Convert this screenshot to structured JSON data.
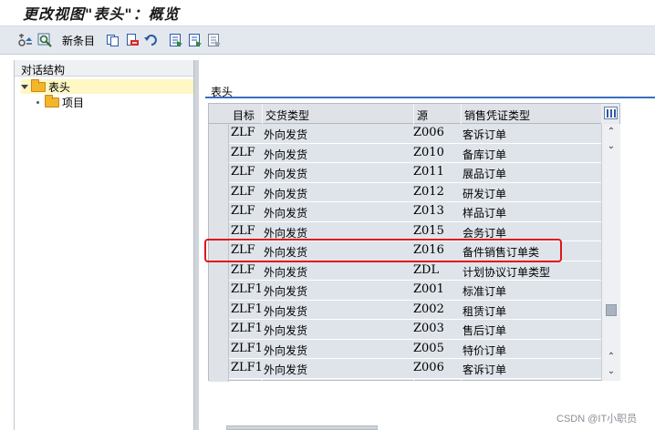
{
  "window": {
    "title": "更改视图\"表头\"：概览"
  },
  "toolbar": {
    "new_entries_label": "新条目"
  },
  "left_panel": {
    "header": "对话结构",
    "tree": [
      {
        "label": "表头",
        "expanded": true,
        "selected": true
      },
      {
        "label": "项目",
        "expanded": false,
        "selected": false
      }
    ]
  },
  "right_panel": {
    "title": "表头"
  },
  "table": {
    "columns": [
      "目标",
      "交货类型",
      "源",
      "销售凭证类型"
    ],
    "rows": [
      {
        "target": "ZLF",
        "delivery_type": "外向发货",
        "source": "Z006",
        "sales_doc_type": "客诉订单"
      },
      {
        "target": "ZLF",
        "delivery_type": "外向发货",
        "source": "Z010",
        "sales_doc_type": "备库订单"
      },
      {
        "target": "ZLF",
        "delivery_type": "外向发货",
        "source": "Z011",
        "sales_doc_type": "展品订单"
      },
      {
        "target": "ZLF",
        "delivery_type": "外向发货",
        "source": "Z012",
        "sales_doc_type": "研发订单"
      },
      {
        "target": "ZLF",
        "delivery_type": "外向发货",
        "source": "Z013",
        "sales_doc_type": "样品订单"
      },
      {
        "target": "ZLF",
        "delivery_type": "外向发货",
        "source": "Z015",
        "sales_doc_type": "会务订单"
      },
      {
        "target": "ZLF",
        "delivery_type": "外向发货",
        "source": "Z016",
        "sales_doc_type": "备件销售订单类"
      },
      {
        "target": "ZLF",
        "delivery_type": "外向发货",
        "source": "ZDL",
        "sales_doc_type": "计划协议订单类型"
      },
      {
        "target": "ZLF1",
        "delivery_type": "外向发货",
        "source": "Z001",
        "sales_doc_type": "标准订单"
      },
      {
        "target": "ZLF1",
        "delivery_type": "外向发货",
        "source": "Z002",
        "sales_doc_type": "租赁订单"
      },
      {
        "target": "ZLF1",
        "delivery_type": "外向发货",
        "source": "Z003",
        "sales_doc_type": "售后订单"
      },
      {
        "target": "ZLF1",
        "delivery_type": "外向发货",
        "source": "Z005",
        "sales_doc_type": "特价订单"
      },
      {
        "target": "ZLF1",
        "delivery_type": "外向发货",
        "source": "Z006",
        "sales_doc_type": "客诉订单"
      }
    ],
    "highlighted_row_index": 6
  },
  "watermark": "CSDN @IT小职员",
  "colors": {
    "highlight": "#e0161b",
    "toolbar_bg": "#e3e8ee",
    "tree_selected": "#fff7c4"
  }
}
